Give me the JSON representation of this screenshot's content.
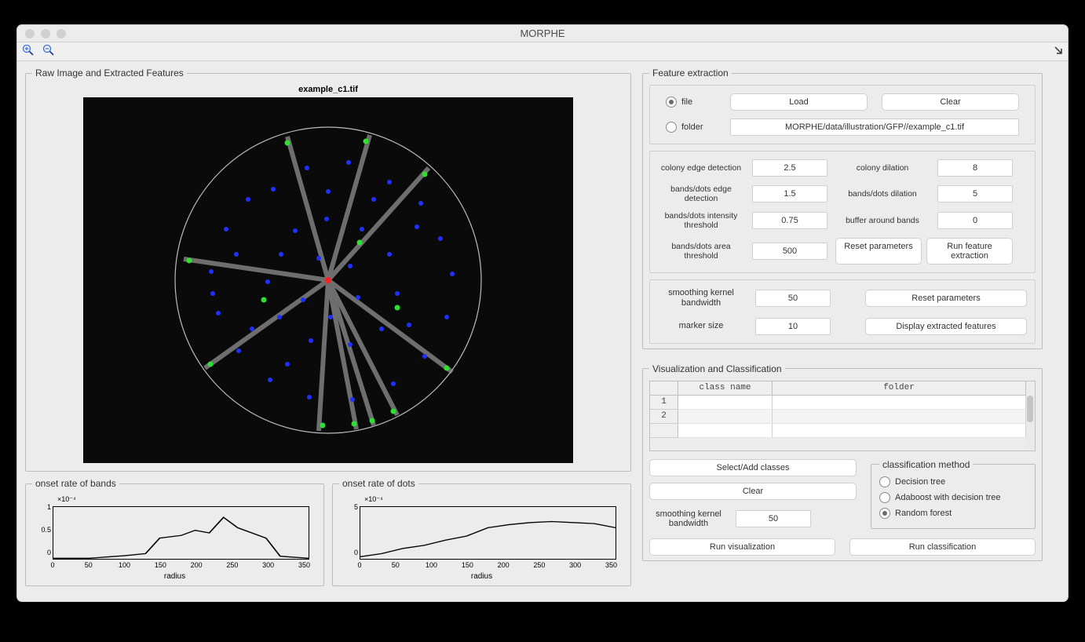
{
  "window": {
    "title": "MORPHE"
  },
  "panels": {
    "raw": "Raw Image and Extracted Features",
    "feat": "Feature extraction",
    "viz": "Visualization and Classification",
    "bands": "onset rate of bands",
    "dots": "onset rate of dots",
    "cm": "classification method"
  },
  "image_title": "example_c1.tif",
  "file": {
    "file_label": "file",
    "folder_label": "folder",
    "load": "Load",
    "clear": "Clear",
    "path": "MORPHE/data/illustration/GFP//example_c1.tif"
  },
  "params": {
    "colony_edge_label": "colony edge detection",
    "colony_edge": "2.5",
    "colony_dilation_label": "colony dilation",
    "colony_dilation": "8",
    "bd_edge_label": "bands/dots edge detection",
    "bd_edge": "1.5",
    "bd_dilation_label": "bands/dots dilation",
    "bd_dilation": "5",
    "bd_intensity_label": "bands/dots intensity threshold",
    "bd_intensity": "0.75",
    "buffer_label": "buffer around bands",
    "buffer": "0",
    "bd_area_label": "bands/dots area threshold",
    "bd_area": "500",
    "reset": "Reset parameters",
    "run": "Run feature extraction"
  },
  "display": {
    "skb_label": "smoothing kernel bandwidth",
    "skb": "50",
    "marker_label": "marker size",
    "marker": "10",
    "reset": "Reset parameters",
    "show": "Display extracted features"
  },
  "table": {
    "h_class": "class name",
    "h_folder": "folder",
    "rows": [
      "1",
      "2",
      ""
    ]
  },
  "viz": {
    "select_add": "Select/Add classes",
    "clear": "Clear",
    "skb_label": "smoothing kernel bandwidth",
    "skb": "50",
    "run_viz": "Run visualization",
    "run_class": "Run classification"
  },
  "cm": {
    "dt": "Decision tree",
    "ada": "Adaboost with decision tree",
    "rf": "Random forest"
  },
  "plot_bands": {
    "exp": "×10⁻⁴",
    "yticks": [
      "1",
      "0.5",
      "0"
    ],
    "xticks": [
      "0",
      "50",
      "100",
      "150",
      "200",
      "250",
      "300",
      "350"
    ],
    "xlabel": "radius"
  },
  "plot_dots": {
    "exp": "×10⁻⁴",
    "yticks": [
      "5",
      "0"
    ],
    "xticks": [
      "0",
      "50",
      "100",
      "150",
      "200",
      "250",
      "300",
      "350"
    ],
    "xlabel": "radius"
  },
  "chart_data": [
    {
      "type": "line",
      "title": "onset rate of bands",
      "xlabel": "radius",
      "ylabel": "",
      "ylim": [
        0,
        0.0001
      ],
      "xlim": [
        0,
        360
      ],
      "x": [
        0,
        50,
        100,
        130,
        150,
        180,
        200,
        220,
        240,
        260,
        280,
        300,
        320,
        360
      ],
      "y": [
        0,
        0,
        5e-06,
        1e-05,
        4e-05,
        4.5e-05,
        5.5e-05,
        5e-05,
        8e-05,
        6e-05,
        5e-05,
        4e-05,
        5e-06,
        0.0
      ]
    },
    {
      "type": "line",
      "title": "onset rate of dots",
      "xlabel": "radius",
      "ylabel": "",
      "ylim": [
        0,
        0.0005
      ],
      "xlim": [
        0,
        360
      ],
      "x": [
        0,
        30,
        60,
        90,
        120,
        150,
        180,
        210,
        240,
        270,
        300,
        330,
        360
      ],
      "y": [
        2e-05,
        5e-05,
        0.0001,
        0.00013,
        0.00018,
        0.00022,
        0.0003,
        0.00033,
        0.00035,
        0.00036,
        0.00035,
        0.00034,
        0.0003
      ]
    }
  ]
}
